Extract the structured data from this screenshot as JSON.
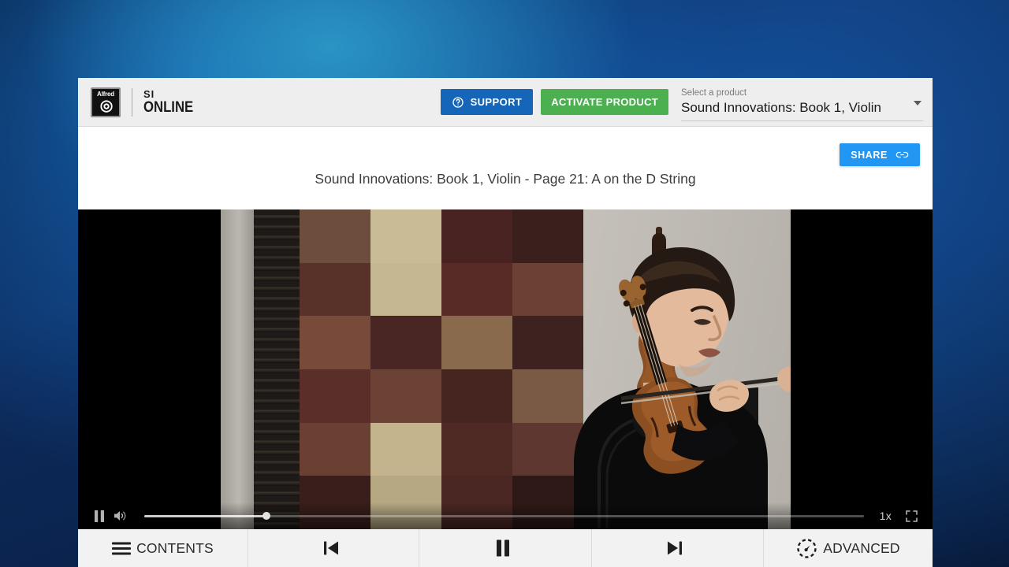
{
  "window": {
    "app_name": "SI ONLINE",
    "brand_mark": "Alfred",
    "brand_line1": "SI",
    "brand_line2": "ONLINE"
  },
  "header": {
    "support_label": "SUPPORT",
    "support_icon": "help-circle-icon",
    "activate_label": "ACTIVATE PRODUCT",
    "product_picker": {
      "label": "Select a product",
      "value": "Sound Innovations: Book 1, Violin",
      "caret_icon": "chevron-down-icon"
    }
  },
  "title_band": {
    "share_label": "SHARE",
    "share_icon": "link-icon",
    "page_title": "Sound Innovations: Book 1, Violin - Page 21: A on the D String"
  },
  "video": {
    "play_state_icon": "pause-icon",
    "volume_icon": "volume-on-icon",
    "progress_percent": 17,
    "speed_label": "1x",
    "fullscreen_icon": "fullscreen-icon",
    "scene_description": "Violinist in black turtleneck playing violin in front of a checkered tapestry"
  },
  "toolbar": {
    "items": [
      {
        "label": "CONTENTS",
        "icon": "hamburger-menu-icon",
        "name": "contents"
      },
      {
        "label": "",
        "icon": "skip-previous-icon",
        "name": "previous"
      },
      {
        "label": "",
        "icon": "pause-icon",
        "name": "play-pause"
      },
      {
        "label": "",
        "icon": "skip-next-icon",
        "name": "next"
      },
      {
        "label": "ADVANCED",
        "icon": "gauge-icon",
        "name": "advanced"
      }
    ]
  },
  "colors": {
    "support_blue": "#1565b8",
    "activate_green": "#4caf50",
    "share_blue": "#2196f3",
    "header_bg": "#eeeeee",
    "toolbar_bg": "#f2f2f2"
  }
}
